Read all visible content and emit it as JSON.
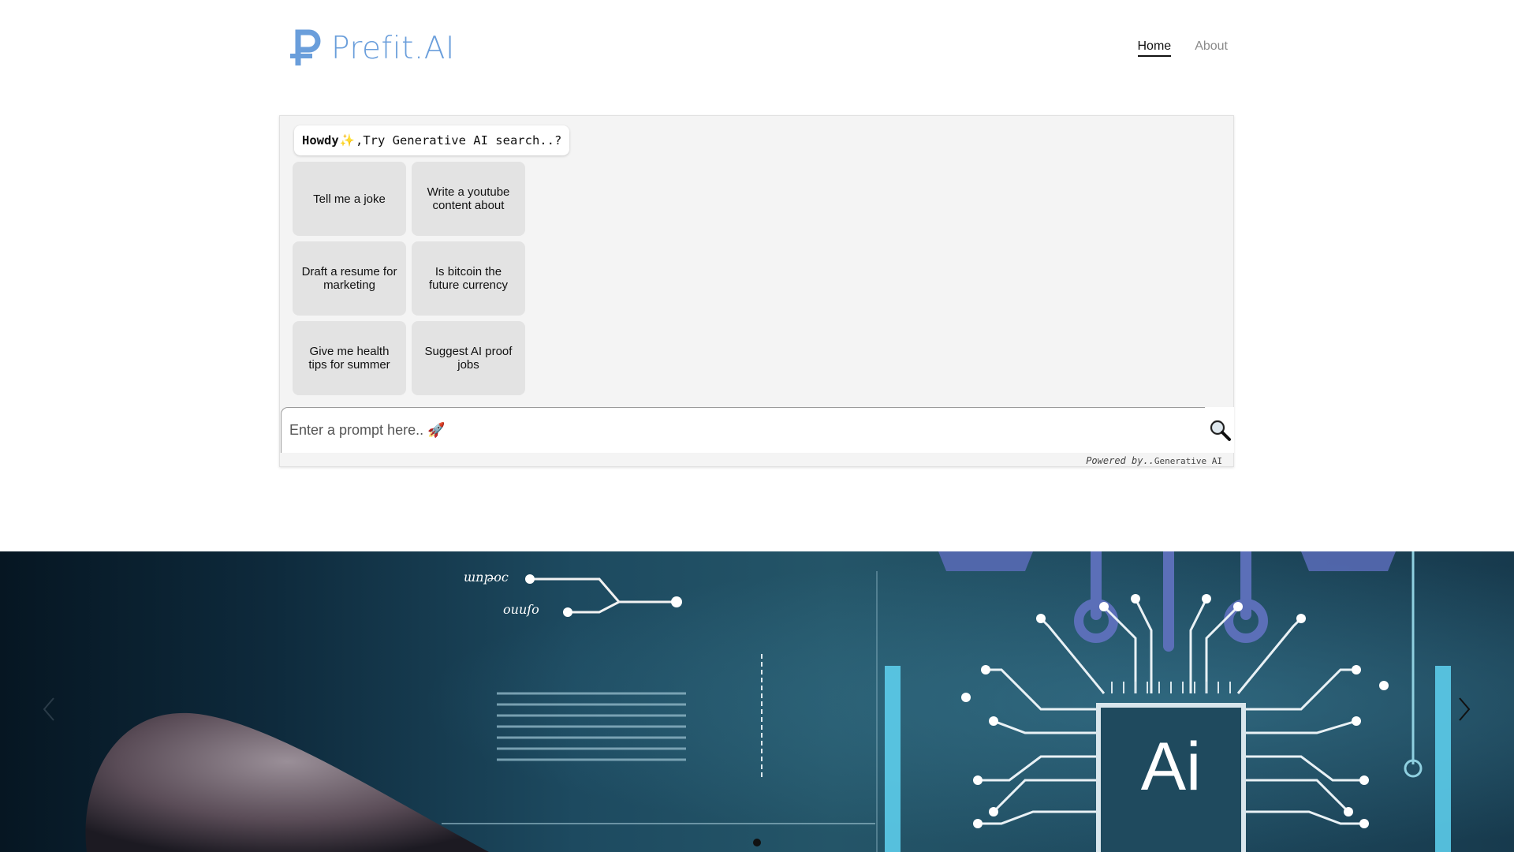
{
  "header": {
    "brand": "Prefit.AI",
    "nav": [
      {
        "label": "Home",
        "active": true
      },
      {
        "label": "About",
        "active": false
      }
    ]
  },
  "chat": {
    "greeting_bold": "Howdy",
    "greeting_icon": "sparkle-icon",
    "greeting_rest": ",Try Generative AI search..?",
    "suggestions": [
      "Tell me a joke",
      "Write a youtube content about",
      "Draft a resume for marketing",
      "Is bitcoin the future currency",
      "Give me health tips for summer",
      "Suggest AI proof jobs"
    ],
    "prompt_placeholder": "Enter a prompt here.. 🚀",
    "search_icon": "magnifier-icon",
    "powered_by": "Powered by..",
    "powered_name": "Generative AI"
  },
  "hero": {
    "chip_label": "Ai",
    "circuit_labels": [
      "աոթoc",
      "ouuſo"
    ],
    "slide_count": 1,
    "active_slide": 1
  },
  "colors": {
    "brand": "#6a9edb",
    "panel_bg": "#f4f4f4",
    "chip_bg": "#e3e3e3",
    "hero_bg": "#1d4a60"
  }
}
